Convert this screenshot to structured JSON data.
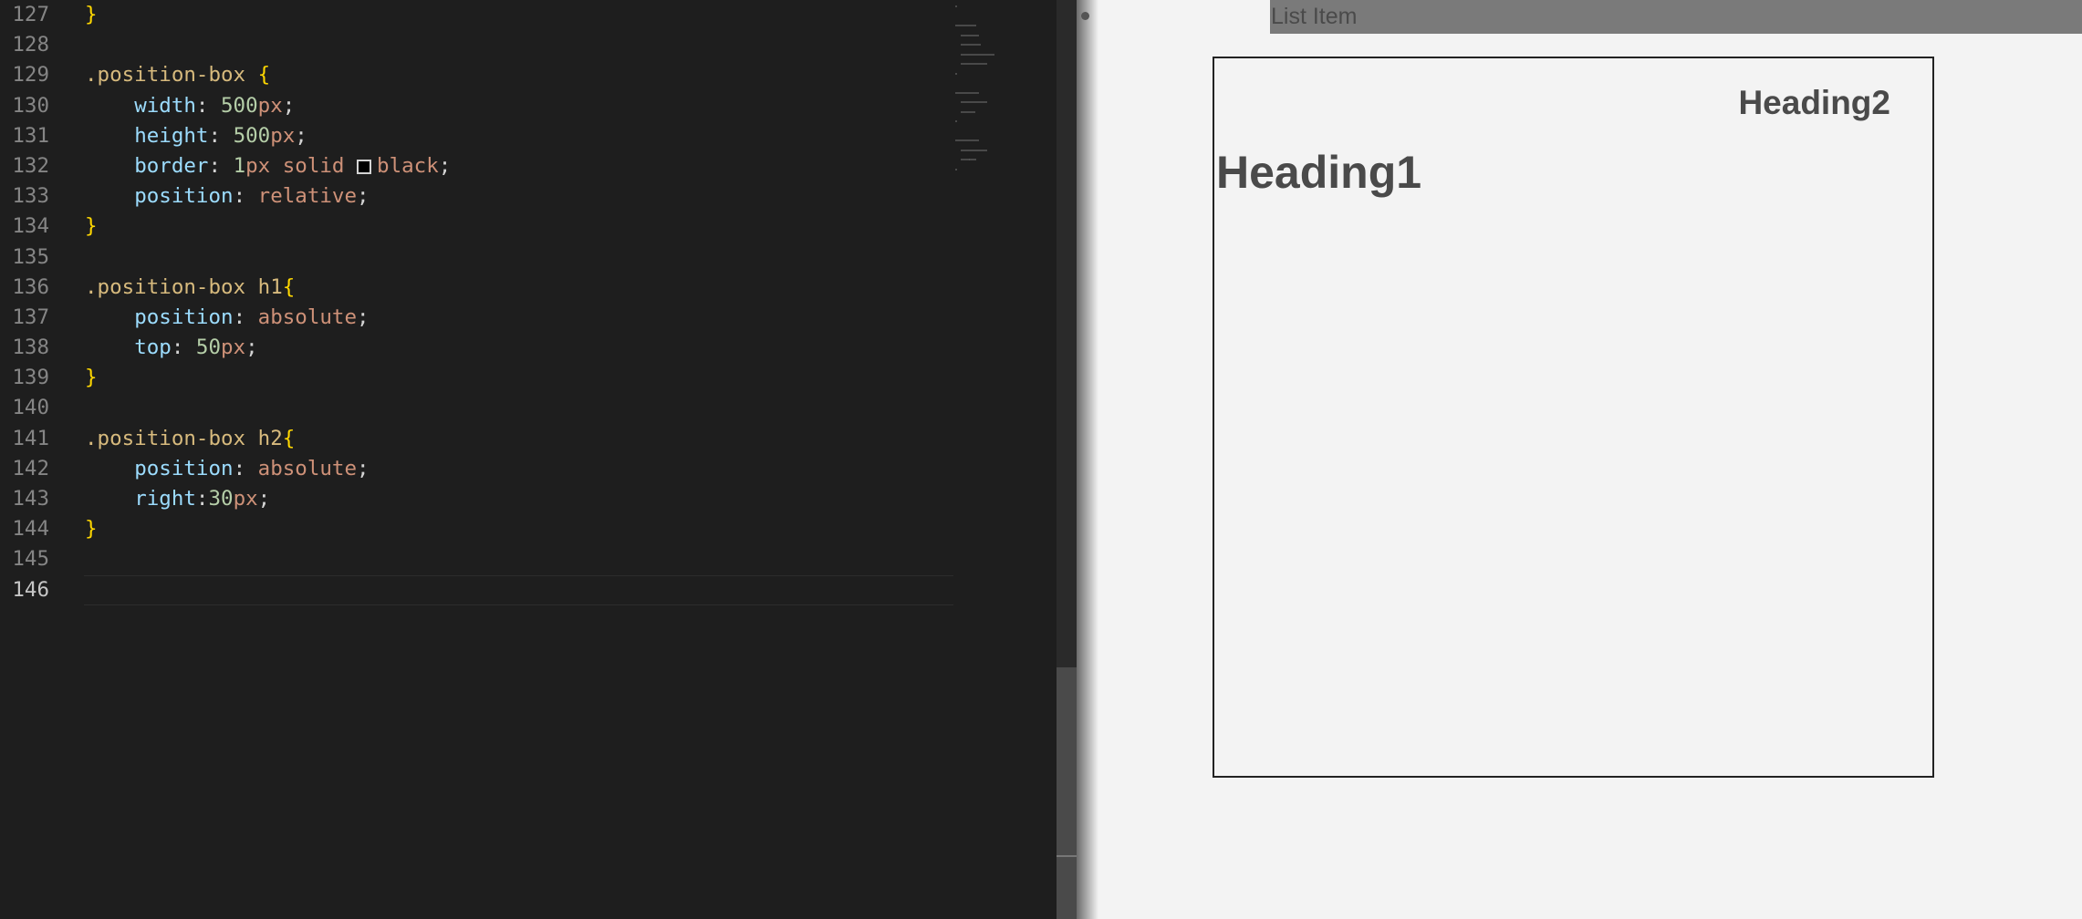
{
  "editor": {
    "lines": [
      {
        "num": "127",
        "tokens": [
          {
            "t": "}",
            "c": "tok-brace"
          }
        ]
      },
      {
        "num": "128",
        "tokens": []
      },
      {
        "num": "129",
        "tokens": [
          {
            "t": ".position-box ",
            "c": "tok-sel"
          },
          {
            "t": "{",
            "c": "tok-brace"
          }
        ]
      },
      {
        "num": "130",
        "tokens": [
          {
            "t": "    ",
            "c": ""
          },
          {
            "t": "width",
            "c": "tok-prop"
          },
          {
            "t": ": ",
            "c": "tok-punc"
          },
          {
            "t": "500",
            "c": "tok-num"
          },
          {
            "t": "px",
            "c": "tok-val"
          },
          {
            "t": ";",
            "c": "tok-punc"
          }
        ]
      },
      {
        "num": "131",
        "tokens": [
          {
            "t": "    ",
            "c": ""
          },
          {
            "t": "height",
            "c": "tok-prop"
          },
          {
            "t": ": ",
            "c": "tok-punc"
          },
          {
            "t": "500",
            "c": "tok-num"
          },
          {
            "t": "px",
            "c": "tok-val"
          },
          {
            "t": ";",
            "c": "tok-punc"
          }
        ]
      },
      {
        "num": "132",
        "tokens": [
          {
            "t": "    ",
            "c": ""
          },
          {
            "t": "border",
            "c": "tok-prop"
          },
          {
            "t": ": ",
            "c": "tok-punc"
          },
          {
            "t": "1",
            "c": "tok-num"
          },
          {
            "t": "px",
            "c": "tok-val"
          },
          {
            "t": " solid ",
            "c": "tok-val"
          },
          {
            "t": "",
            "c": "swatch"
          },
          {
            "t": "black",
            "c": "tok-val"
          },
          {
            "t": ";",
            "c": "tok-punc"
          }
        ]
      },
      {
        "num": "133",
        "tokens": [
          {
            "t": "    ",
            "c": ""
          },
          {
            "t": "position",
            "c": "tok-prop"
          },
          {
            "t": ": ",
            "c": "tok-punc"
          },
          {
            "t": "relative",
            "c": "tok-val"
          },
          {
            "t": ";",
            "c": "tok-punc"
          }
        ]
      },
      {
        "num": "134",
        "tokens": [
          {
            "t": "}",
            "c": "tok-brace"
          }
        ]
      },
      {
        "num": "135",
        "tokens": []
      },
      {
        "num": "136",
        "tokens": [
          {
            "t": ".position-box h1",
            "c": "tok-sel"
          },
          {
            "t": "{",
            "c": "tok-brace"
          }
        ]
      },
      {
        "num": "137",
        "tokens": [
          {
            "t": "    ",
            "c": ""
          },
          {
            "t": "position",
            "c": "tok-prop"
          },
          {
            "t": ": ",
            "c": "tok-punc"
          },
          {
            "t": "absolute",
            "c": "tok-val"
          },
          {
            "t": ";",
            "c": "tok-punc"
          }
        ]
      },
      {
        "num": "138",
        "tokens": [
          {
            "t": "    ",
            "c": ""
          },
          {
            "t": "top",
            "c": "tok-prop"
          },
          {
            "t": ": ",
            "c": "tok-punc"
          },
          {
            "t": "50",
            "c": "tok-num"
          },
          {
            "t": "px",
            "c": "tok-val"
          },
          {
            "t": ";",
            "c": "tok-punc"
          }
        ]
      },
      {
        "num": "139",
        "tokens": [
          {
            "t": "}",
            "c": "tok-brace"
          }
        ]
      },
      {
        "num": "140",
        "tokens": []
      },
      {
        "num": "141",
        "tokens": [
          {
            "t": ".position-box h2",
            "c": "tok-sel"
          },
          {
            "t": "{",
            "c": "tok-brace"
          }
        ]
      },
      {
        "num": "142",
        "tokens": [
          {
            "t": "    ",
            "c": ""
          },
          {
            "t": "position",
            "c": "tok-prop"
          },
          {
            "t": ": ",
            "c": "tok-punc"
          },
          {
            "t": "absolute",
            "c": "tok-val"
          },
          {
            "t": ";",
            "c": "tok-punc"
          }
        ]
      },
      {
        "num": "143",
        "tokens": [
          {
            "t": "    ",
            "c": ""
          },
          {
            "t": "right",
            "c": "tok-prop"
          },
          {
            "t": ":",
            "c": "tok-punc"
          },
          {
            "t": "30",
            "c": "tok-num"
          },
          {
            "t": "px",
            "c": "tok-val"
          },
          {
            "t": ";",
            "c": "tok-punc"
          }
        ]
      },
      {
        "num": "144",
        "tokens": [
          {
            "t": "}",
            "c": "tok-brace"
          }
        ]
      },
      {
        "num": "145",
        "tokens": []
      },
      {
        "num": "146",
        "tokens": [],
        "current": true
      }
    ]
  },
  "preview": {
    "list_item": "List Item",
    "heading1": "Heading1",
    "heading2": "Heading2"
  },
  "colors": {
    "editor_bg": "#1e1e1e",
    "preview_bg": "#f3f3f3"
  }
}
